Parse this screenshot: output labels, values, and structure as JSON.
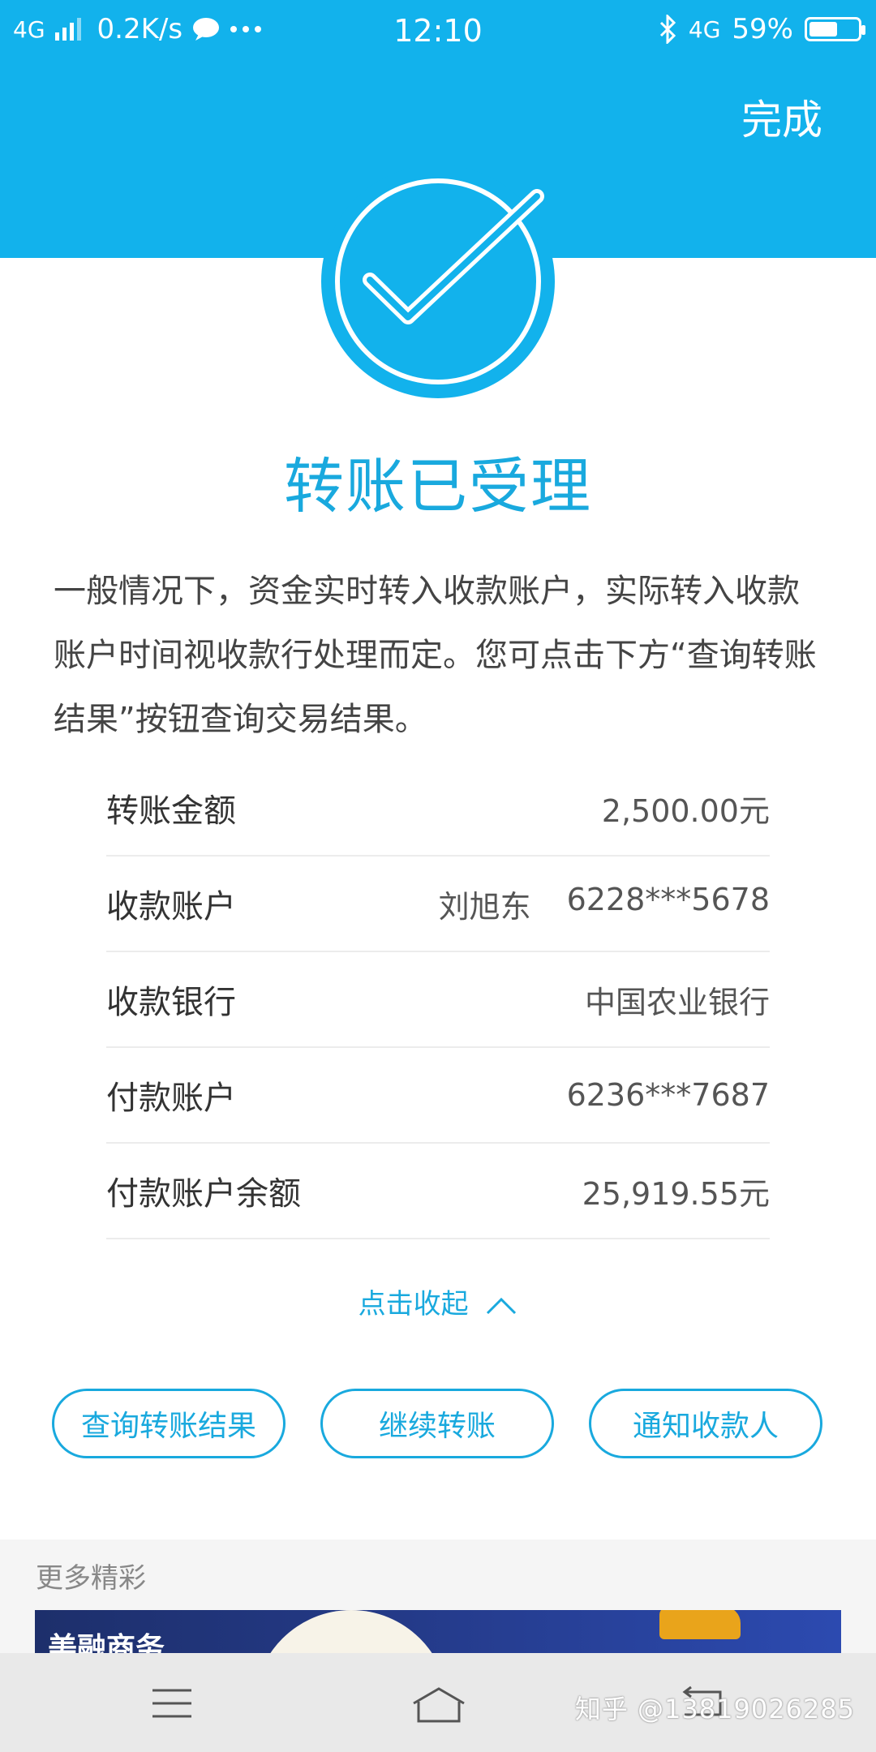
{
  "status_bar": {
    "network": "4G",
    "speed": "0.2K/s",
    "time": "12:10",
    "network_right": "4G",
    "battery": "59%",
    "battery_level": 0.59
  },
  "header": {
    "done_label": "完成"
  },
  "result": {
    "title": "转账已受理",
    "description": "一般情况下，资金实时转入收款账户，实际转入收款账户时间视收款行处理而定。您可点击下方“查询转账结果”按钮查询交易结果。"
  },
  "details": [
    {
      "label": "转账金额",
      "value": "2,500.00元"
    },
    {
      "label": "收款账户",
      "value_name": "刘旭东",
      "value": "6228***5678"
    },
    {
      "label": "收款银行",
      "value": "中国农业银行"
    },
    {
      "label": "付款账户",
      "value": "6236***7687"
    },
    {
      "label": "付款账户余额",
      "value": "25,919.55元"
    }
  ],
  "collapse_label": "点击收起",
  "actions": [
    {
      "label": "查询转账结果"
    },
    {
      "label": "继续转账"
    },
    {
      "label": "通知收款人"
    }
  ],
  "more": {
    "title": "更多精彩",
    "banner_text": "美融商务"
  },
  "watermark": "知乎 @13819026285",
  "colors": {
    "primary": "#12b2ec",
    "accent_text": "#19a9de"
  }
}
